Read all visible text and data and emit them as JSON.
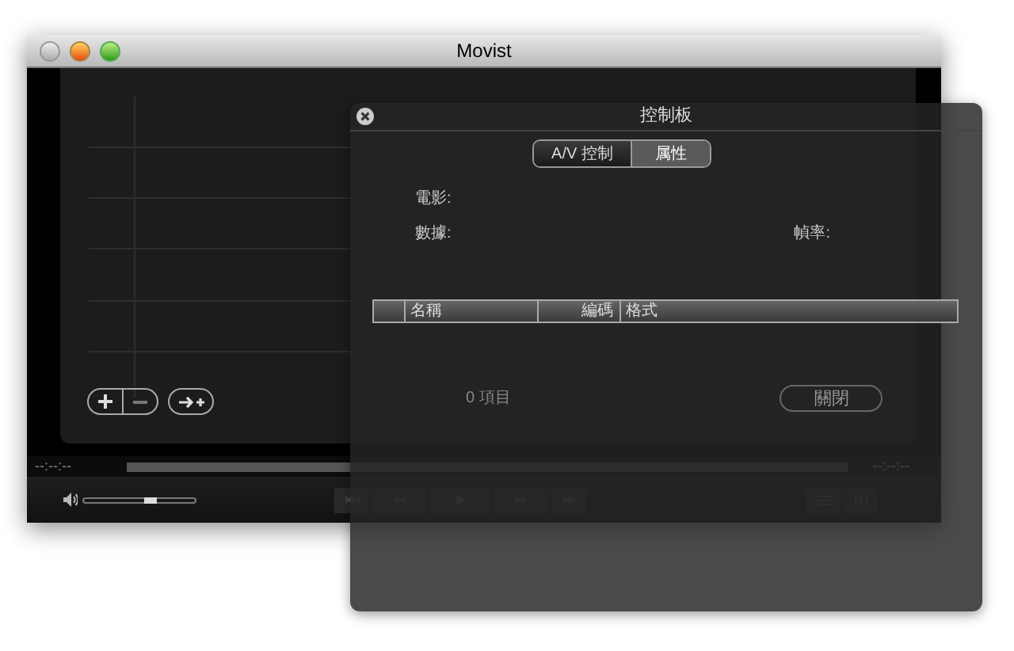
{
  "main_window": {
    "title": "Movist",
    "time_elapsed": "--:--:--",
    "time_remaining": "--:--:--",
    "volume": {
      "level": 0.6
    }
  },
  "panel": {
    "title": "控制板",
    "tabs": [
      {
        "label": "A/V 控制",
        "selected": false
      },
      {
        "label": "属性",
        "selected": true
      }
    ],
    "fields": [
      {
        "label": "電影:"
      },
      {
        "label": "數據:"
      },
      {
        "label": "幀率:"
      }
    ],
    "table": {
      "columns": [
        "名稱",
        "編碼",
        "格式"
      ]
    },
    "item_count": "0 項目",
    "close_button": "關閉"
  }
}
